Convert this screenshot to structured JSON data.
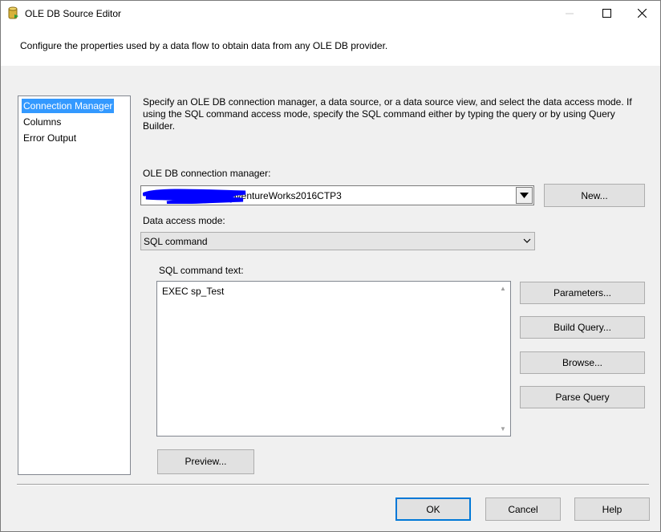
{
  "window": {
    "title": "OLE DB Source Editor",
    "controls": {
      "minimize": "minimize-icon",
      "maximize": "maximize-icon",
      "close": "close-icon"
    }
  },
  "header": {
    "description": "Configure the properties used by a data flow to obtain data from any OLE DB provider."
  },
  "nav": {
    "items": [
      {
        "label": "Connection Manager",
        "selected": true
      },
      {
        "label": "Columns",
        "selected": false
      },
      {
        "label": "Error Output",
        "selected": false
      }
    ]
  },
  "main": {
    "instructions": "Specify an OLE DB connection manager, a data source, or a data source view, and select the data access mode. If using the SQL command access mode, specify the SQL command either by typing the query or by using Query Builder.",
    "connection_label": "OLE DB connection manager:",
    "connection_value": "dventureWorks2016CTP3",
    "new_button": "New...",
    "access_mode_label": "Data access mode:",
    "access_mode_value": "SQL command",
    "sql_label": "SQL command text:",
    "sql_text": "EXEC sp_Test",
    "buttons": {
      "parameters": "Parameters...",
      "build_query": "Build Query...",
      "browse": "Browse...",
      "parse_query": "Parse Query",
      "preview": "Preview..."
    }
  },
  "footer": {
    "ok": "OK",
    "cancel": "Cancel",
    "help": "Help"
  },
  "colors": {
    "selection": "#3399ff",
    "default_button_border": "#0078d7",
    "redaction": "#0000ff"
  }
}
